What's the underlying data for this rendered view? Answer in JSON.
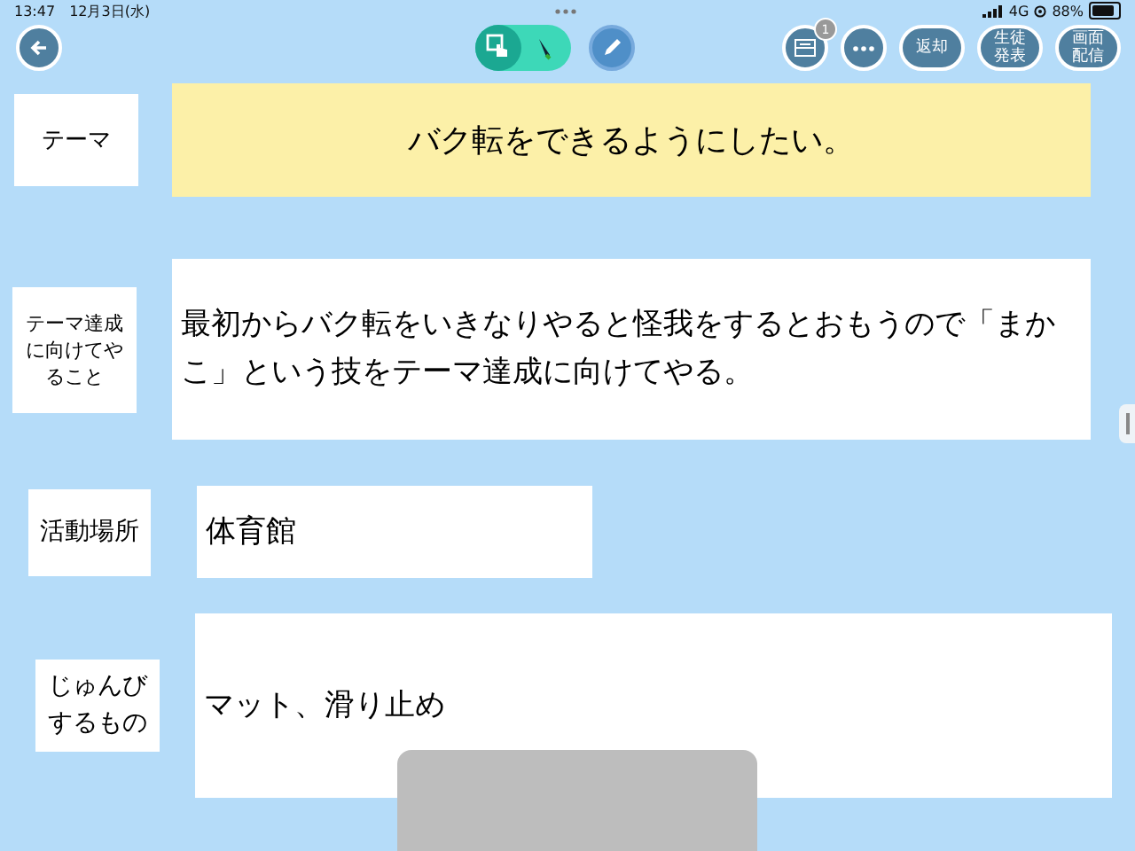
{
  "status_bar": {
    "time": "13:47",
    "date": "12月3日(水)",
    "network": "4G",
    "battery": "88%"
  },
  "toolbar": {
    "modes": [
      {
        "kind": "touch",
        "selected": true
      },
      {
        "kind": "pen",
        "selected": false
      }
    ],
    "inbox_badge": "1",
    "buttons": [
      "返却",
      "生徒発表",
      "画面配信"
    ]
  },
  "rows": [
    {
      "label": "テーマ",
      "value": "バク転をできるようにしたい。",
      "kind": "highlight"
    },
    {
      "label": "テーマ達成に向けてやること",
      "value": "最初からバク転をいきなりやると怪我をするとおもうので「まかこ」という技をテーマ達成に向けてやる。",
      "kind": "plain"
    },
    {
      "label": "活動場所",
      "value": "体育館",
      "kind": "plain"
    },
    {
      "label": "じゅんびするもの",
      "value": "マット、滑り止め",
      "kind": "plain"
    }
  ]
}
